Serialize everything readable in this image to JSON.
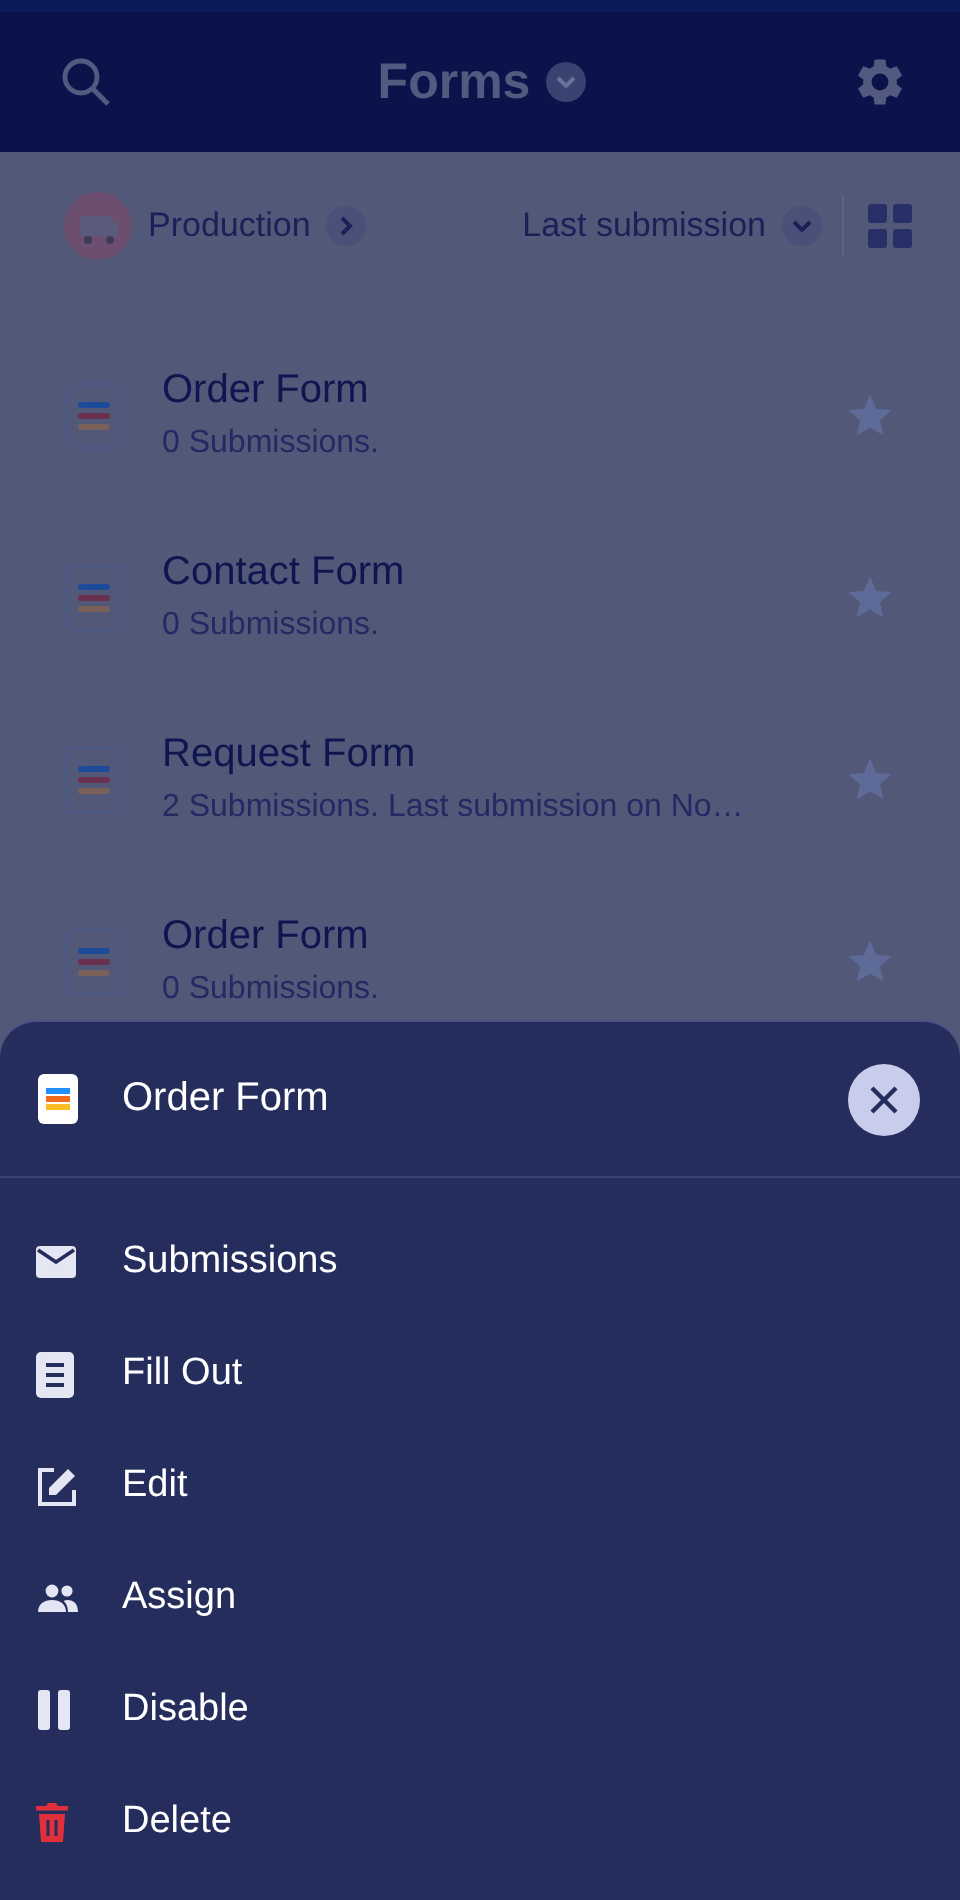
{
  "header": {
    "title": "Forms"
  },
  "toolbar": {
    "workspace": "Production",
    "sort": "Last submission"
  },
  "forms": [
    {
      "title": "Order Form",
      "subtitle": "0 Submissions.",
      "starred": false
    },
    {
      "title": "Contact Form",
      "subtitle": "0 Submissions.",
      "starred": false
    },
    {
      "title": "Request Form",
      "subtitle": "2 Submissions. Last submission on No…",
      "starred": false
    },
    {
      "title": "Order Form",
      "subtitle": "0 Submissions.",
      "starred": false
    }
  ],
  "sheet": {
    "title": "Order Form",
    "actions": [
      {
        "label": "Submissions",
        "kind": "mail"
      },
      {
        "label": "Fill Out",
        "kind": "fill"
      },
      {
        "label": "Edit",
        "kind": "edit"
      },
      {
        "label": "Assign",
        "kind": "assign"
      },
      {
        "label": "Disable",
        "kind": "pause"
      },
      {
        "label": "Delete",
        "kind": "delete"
      }
    ]
  }
}
